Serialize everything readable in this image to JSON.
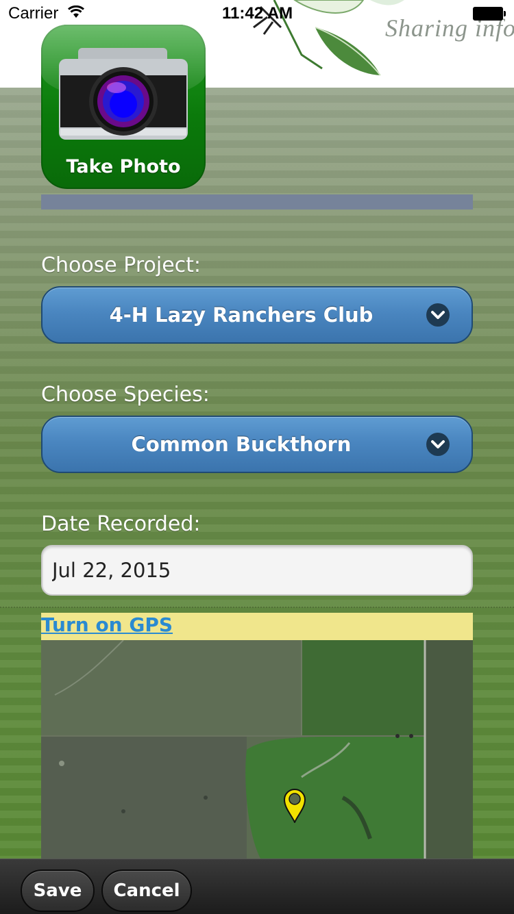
{
  "status_bar": {
    "carrier": "Carrier",
    "time": "11:42 AM"
  },
  "header": {
    "tagline": "Sharing info"
  },
  "take_photo": {
    "label": "Take Photo"
  },
  "form": {
    "project_label": "Choose Project:",
    "project_value": "4-H Lazy Ranchers Club",
    "species_label": "Choose Species:",
    "species_value": "Common Buckthorn",
    "date_label": "Date Recorded:",
    "date_value": "Jul 22, 2015"
  },
  "gps": {
    "link_text": "Turn on GPS"
  },
  "toolbar": {
    "save_label": "Save",
    "cancel_label": "Cancel"
  },
  "colors": {
    "select_button": "#4a86c0",
    "gps_strip": "#f0e68c",
    "gps_link": "#2a8ad1",
    "take_photo": "#0b7a0b",
    "divider": "#76839a"
  },
  "icons": {
    "wifi": "wifi-icon",
    "battery": "battery-icon",
    "camera": "camera-icon",
    "chevron": "chevron-down-icon",
    "pin": "map-pin-icon"
  }
}
